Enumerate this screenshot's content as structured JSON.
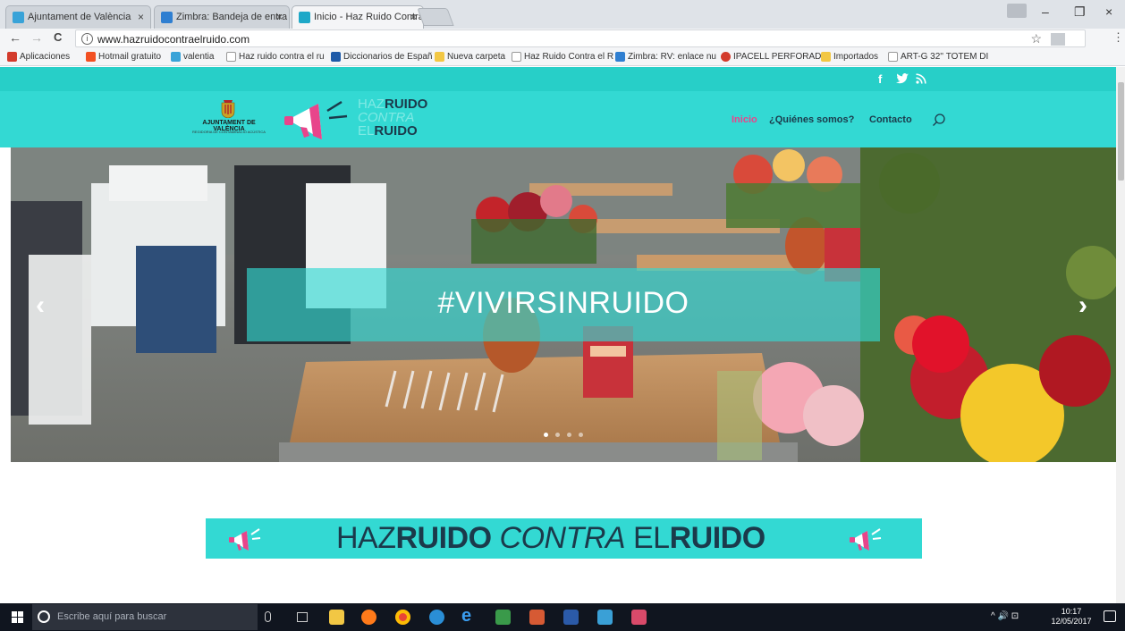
{
  "browser": {
    "tabs": [
      {
        "label": "Ajuntament de València",
        "active": false
      },
      {
        "label": "Zimbra: Bandeja de entra",
        "active": false
      },
      {
        "label": "Inicio - Haz Ruido Contra",
        "active": true
      }
    ],
    "tab_close_glyph": "×",
    "window_controls": {
      "minimize": "–",
      "maximize": "❐",
      "close": "×"
    },
    "nav": {
      "back": "←",
      "forward": "→",
      "reload": "C"
    },
    "info_glyph": "i",
    "url": "www.hazruidocontraelruido.com",
    "star_glyph": "☆",
    "menu_glyph": "⋮",
    "bookmarks": [
      {
        "label": "Aplicaciones",
        "color": "#d33b2c"
      },
      {
        "label": "Hotmail gratuito",
        "color": "#f25022"
      },
      {
        "label": "valentia",
        "color": "#39a3d8"
      },
      {
        "label": "Haz ruido contra el ru",
        "color": "#9aa0a6"
      },
      {
        "label": "Diccionarios de Españ",
        "color": "#1e5aa8"
      },
      {
        "label": "Nueva carpeta",
        "color": "#f2c744"
      },
      {
        "label": "Haz Ruido Contra el R",
        "color": "#9aa0a6"
      },
      {
        "label": "Zimbra: RV: enlace nu",
        "color": "#2f7fd1"
      },
      {
        "label": "IPACELL PERFORADO",
        "color": "#d33b2c"
      },
      {
        "label": "Importados",
        "color": "#f2c744"
      },
      {
        "label": "ART-G 32'' TOTEM DI",
        "color": "#9aa0a6"
      }
    ]
  },
  "site": {
    "social": {
      "facebook": "f",
      "twitter": "🐦",
      "rss": "⌇"
    },
    "logo": {
      "ajuntament_name": "AJUNTAMENT DE VALÈNCIA",
      "ajuntament_sub": "REGIDORIA DE CONTAMINACIÓ ACÚSTICA",
      "brand_line1_light": "HAZ",
      "brand_line1_bold": "RUIDO",
      "brand_line2": "CONTRA",
      "brand_line3_light": "EL",
      "brand_line3_bold": "RUIDO"
    },
    "nav": [
      {
        "label": "Inicio",
        "active": true
      },
      {
        "label": "¿Quiénes somos?",
        "active": false
      },
      {
        "label": "Contacto",
        "active": false
      }
    ],
    "colors": {
      "accent": "#33d9d3",
      "nav_active": "#e8458b",
      "dark_text": "#1b3a4b"
    },
    "hero": {
      "caption": "#VIVIRSINRUIDO",
      "prev_glyph": "‹",
      "next_glyph": "›",
      "slides": 4,
      "active_slide": 1
    },
    "banner": {
      "part1": "HAZ",
      "part2": "RUIDO",
      "part3": " CONTRA",
      "part4": " EL",
      "part5": "RUIDO"
    }
  },
  "taskbar": {
    "search_placeholder": "Escribe aquí para buscar",
    "tray_glyphs": "^ 🔊 ⊡",
    "time": "10:17",
    "date": "12/05/2017"
  }
}
